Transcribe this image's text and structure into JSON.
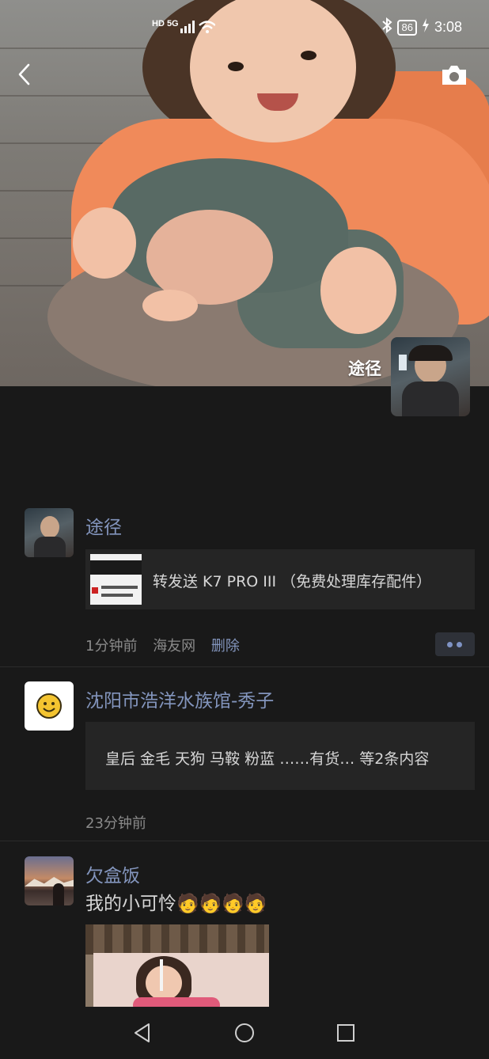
{
  "status_bar": {
    "network": "HD 5G",
    "battery": "86",
    "time": "3:08"
  },
  "header": {
    "back_icon": "back-arrow-icon",
    "camera_icon": "camera-icon",
    "owner_name": "途径"
  },
  "posts": [
    {
      "author": "途径",
      "shared_title": "转发送 K7 PRO III （免费处理库存配件）",
      "time": "1分钟前",
      "source": "海友网",
      "delete_label": "删除",
      "more_icon": "more-dots-icon"
    },
    {
      "author": "沈阳市浩洋水族馆-秀子",
      "folded_text": "皇后  金毛 天狗 马鞍 粉蓝 ……有货…  等2条内容",
      "time": "23分钟前"
    },
    {
      "author": "欠盒饭",
      "text": "我的小可怜",
      "emoji": "🧑🧑🧑🧑"
    }
  ],
  "nav": {
    "back": "nav-back-icon",
    "home": "nav-home-icon",
    "recents": "nav-recents-icon"
  },
  "colors": {
    "background": "#191919",
    "name_link": "#8395bd",
    "card": "#252525"
  }
}
